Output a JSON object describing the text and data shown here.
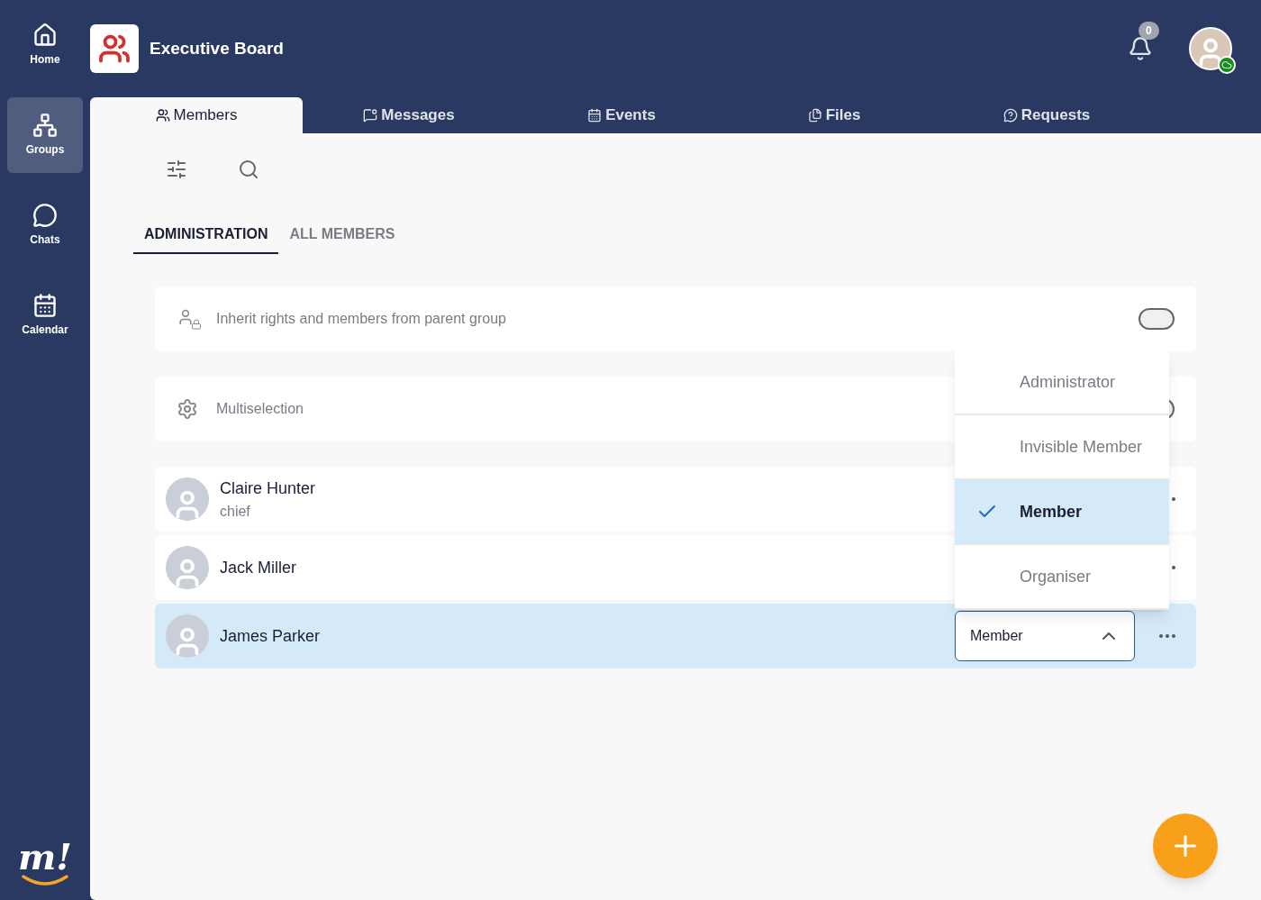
{
  "sidebar": {
    "items": [
      {
        "label": "Home",
        "selected": false
      },
      {
        "label": "Groups",
        "selected": true
      },
      {
        "label": "Chats",
        "selected": false
      },
      {
        "label": "Calendar",
        "selected": false
      }
    ],
    "logo": "m!"
  },
  "header": {
    "title": "Executive Board",
    "notifications": "0"
  },
  "tabs": [
    {
      "label": "Members",
      "selected": true
    },
    {
      "label": "Messages",
      "selected": false
    },
    {
      "label": "Events",
      "selected": false
    },
    {
      "label": "Files",
      "selected": false
    },
    {
      "label": "Requests",
      "selected": false
    }
  ],
  "subtabs": [
    {
      "label": "ADMINISTRATION",
      "selected": true
    },
    {
      "label": "ALL MEMBERS",
      "selected": false
    }
  ],
  "settings": [
    {
      "label": "Inherit rights and members from parent group",
      "on": false
    },
    {
      "label": "Multiselection",
      "on": false
    }
  ],
  "members": [
    {
      "name": "Claire Hunter",
      "subtitle": "chief",
      "selected": false
    },
    {
      "name": "Jack Miller",
      "selected": false
    },
    {
      "name": "James Parker",
      "selected": true,
      "role": "Member",
      "dropdown_expanded": true
    }
  ],
  "role_options": [
    {
      "label": "Administrator",
      "selected": false
    },
    {
      "label": "Invisible Member",
      "selected": false
    },
    {
      "label": "Member",
      "selected": true
    },
    {
      "label": "Organiser",
      "selected": false
    }
  ]
}
